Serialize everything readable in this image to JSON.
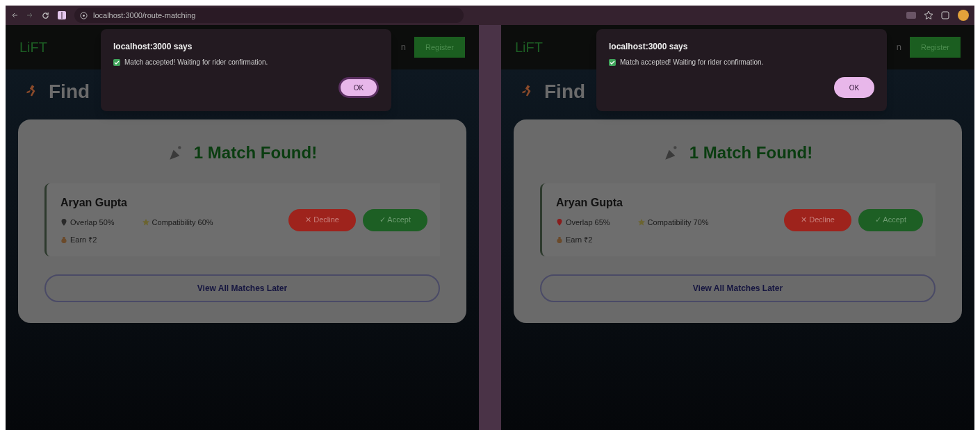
{
  "browser": {
    "url": "localhost:3000/route-matching"
  },
  "panes": [
    {
      "header": {
        "logo": "LiFT",
        "nav_fragment": "n",
        "register": "Register"
      },
      "heading": "Find",
      "results": {
        "title": "1 Match Found!",
        "matches": [
          {
            "name": "Aryan Gupta",
            "overlap": "Overlap 50%",
            "compatibility": "Compatibility 60%",
            "earn": "Earn ₹2",
            "decline": "✕ Decline",
            "accept": "✓ Accept"
          }
        ],
        "later": "View All Matches Later"
      },
      "dialog": {
        "title": "localhost:3000 says",
        "message": "Match accepted! Waiting for rider confirmation.",
        "ok": "OK",
        "focused": true
      }
    },
    {
      "header": {
        "logo": "LiFT",
        "nav_fragment": "n",
        "register": "Register"
      },
      "heading": "Find",
      "results": {
        "title": "1 Match Found!",
        "matches": [
          {
            "name": "Aryan Gupta",
            "overlap": "Overlap 65%",
            "compatibility": "Compatibility 70%",
            "earn": "Earn ₹2",
            "decline": "✕ Decline",
            "accept": "✓ Accept"
          }
        ],
        "later": "View All Matches Later"
      },
      "dialog": {
        "title": "localhost:3000 says",
        "message": "Match accepted! Waiting for rider confirmation.",
        "ok": "OK",
        "focused": false
      }
    }
  ]
}
